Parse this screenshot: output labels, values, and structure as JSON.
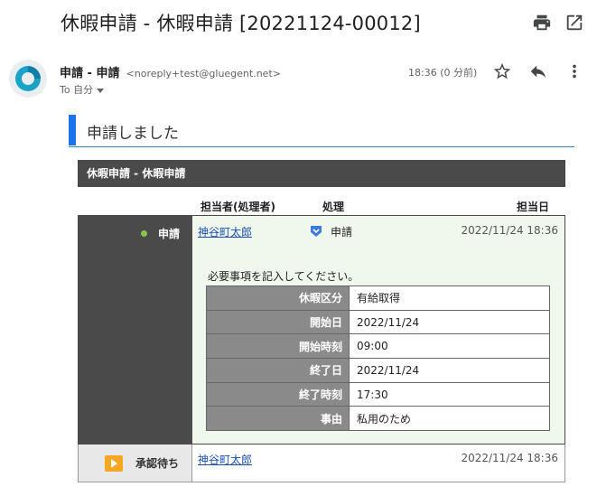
{
  "email": {
    "subject": "休暇申請 - 休暇申請 [20221124-00012]",
    "sender_name": "申請 - 申請",
    "sender_email": "<noreply+test@gluegent.net>",
    "recipient": "To 自分",
    "time": "18:36 (0 分前)"
  },
  "icons": {
    "print": "printer-icon",
    "open_new": "open-in-new-icon",
    "star": "star-icon",
    "reply": "reply-icon",
    "more": "more-vert-icon"
  },
  "colors": {
    "accent_blue": "#1a73e8",
    "dark_header": "#4a4a4a",
    "status_green": "#8bc34a",
    "pending_orange": "#f5a623",
    "detail_label_bg": "#8a8a8a"
  },
  "body": {
    "banner": "申請しました",
    "workflow_title": "休暇申請 - 休暇申請",
    "headers": {
      "assignee": "担当者(処理者)",
      "action": "処理",
      "date": "担当日"
    },
    "steps": [
      {
        "status": "申請",
        "assignee": "神谷町太郎",
        "action": "申請",
        "date": "2022/11/24 18:36",
        "note": "必要事項を記入してください。",
        "fields": [
          {
            "label": "休暇区分",
            "value": "有給取得"
          },
          {
            "label": "開始日",
            "value": "2022/11/24"
          },
          {
            "label": "開始時刻",
            "value": "09:00"
          },
          {
            "label": "終了日",
            "value": "2022/11/24"
          },
          {
            "label": "終了時刻",
            "value": "17:30"
          },
          {
            "label": "事由",
            "value": "私用のため"
          }
        ]
      },
      {
        "status": "承認待ち",
        "assignee": "神谷町太郎",
        "date": "2022/11/24 18:36"
      }
    ]
  }
}
